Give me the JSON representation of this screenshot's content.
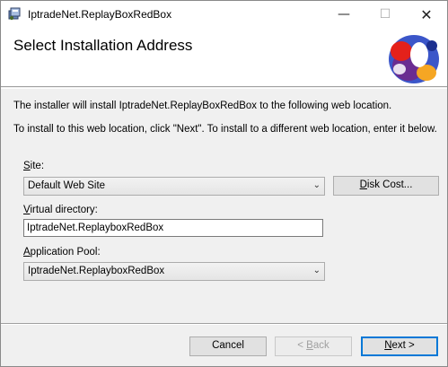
{
  "window": {
    "title": "IptradeNet.ReplayBoxRedBox",
    "minimize_glyph": "—",
    "maximize_glyph": "☐",
    "close_glyph": "✕"
  },
  "header": {
    "title": "Select Installation Address"
  },
  "body": {
    "line1": "The installer will install IptradeNet.ReplayBoxRedBox to the following web location.",
    "line2": "To install to this web location, click \"Next\". To install to a different web location, enter it below."
  },
  "site": {
    "label_mnemonic": "S",
    "label_rest": "ite:",
    "value": "Default Web Site"
  },
  "vdir": {
    "label_mnemonic": "V",
    "label_rest": "irtual directory:",
    "value": "IptradeNet.ReplayboxRedBox"
  },
  "pool": {
    "label_mnemonic": "A",
    "label_rest": "pplication Pool:",
    "value": "IptradeNet.ReplayboxRedBox"
  },
  "buttons": {
    "disk_mnemonic": "D",
    "disk_rest": "isk Cost...",
    "cancel": "Cancel",
    "back_prefix": "< ",
    "back_mnemonic": "B",
    "back_rest": "ack",
    "next_mnemonic": "N",
    "next_rest": "ext >"
  },
  "icons": {
    "app": "installer-package-icon",
    "logo": "bt-globe-logo",
    "dropdown": "chevron-down-icon"
  },
  "colors": {
    "accent": "#0078d7",
    "logo_blue": "#3b56c9",
    "logo_red": "#e4211b",
    "logo_orange": "#f5a623",
    "logo_purple": "#6a2c91"
  }
}
